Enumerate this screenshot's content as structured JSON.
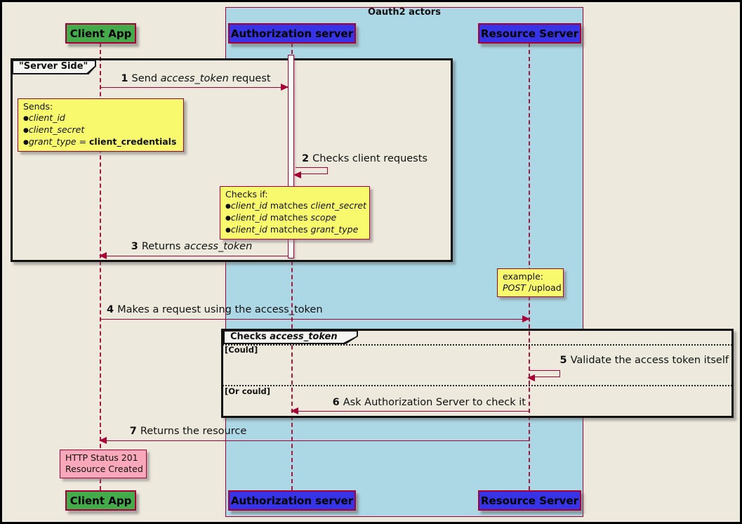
{
  "title": "Oauth2 actors",
  "colors": {
    "background": "#EDE9DD",
    "actors_box_fill": "#ACD8E5",
    "client_fill": "#43AB49",
    "server_fill": "#3734E8",
    "note_fill": "#F9F96D",
    "note_pink_fill": "#F8A8B8",
    "line": "#A80036",
    "frame_border": "#101010"
  },
  "participants": {
    "client": "Client App",
    "auth": "Authorization server",
    "resource": "Resource Server"
  },
  "frames": {
    "server_side": {
      "label": "\"Server Side\""
    },
    "alt": {
      "label_plain": "Checks ",
      "label_italic": "access_token",
      "guard_could": "[Could]",
      "guard_or_could": "[Or could]"
    }
  },
  "messages": {
    "m1": {
      "num": "1",
      "pre": "Send ",
      "em": "access_token",
      "post": " request"
    },
    "m2": {
      "num": "2",
      "text": "Checks client requests"
    },
    "m3": {
      "num": "3",
      "pre": "Returns ",
      "em": "access_token",
      "post": ""
    },
    "m4": {
      "num": "4",
      "text": "Makes a request using the access_token"
    },
    "m5": {
      "num": "5",
      "text": "Validate the access token itself"
    },
    "m6": {
      "num": "6",
      "text": "Ask Authorization Server to check it"
    },
    "m7": {
      "num": "7",
      "text": "Returns the resource"
    }
  },
  "notes": {
    "sends": {
      "title": "Sends:",
      "bullet": "●",
      "item1": "client_id",
      "item2": "client_secret",
      "item3_em": "grant_type",
      "item3_mid": " = ",
      "item3_bold": "client_credentials"
    },
    "checks": {
      "title": "Checks if:",
      "bullet": "●",
      "rows": [
        {
          "a": "client_id",
          "mid": " matches ",
          "b": "client_secret"
        },
        {
          "a": "client_id",
          "mid": " matches ",
          "b": "scope"
        },
        {
          "a": "client_id",
          "mid": " matches ",
          "b": "grant_type"
        }
      ]
    },
    "example": {
      "line1": "example:",
      "line2_em": "POST",
      "line2_rest": " /upload"
    },
    "status": {
      "line1": "HTTP Status 201",
      "line2": "Resource Created"
    }
  }
}
